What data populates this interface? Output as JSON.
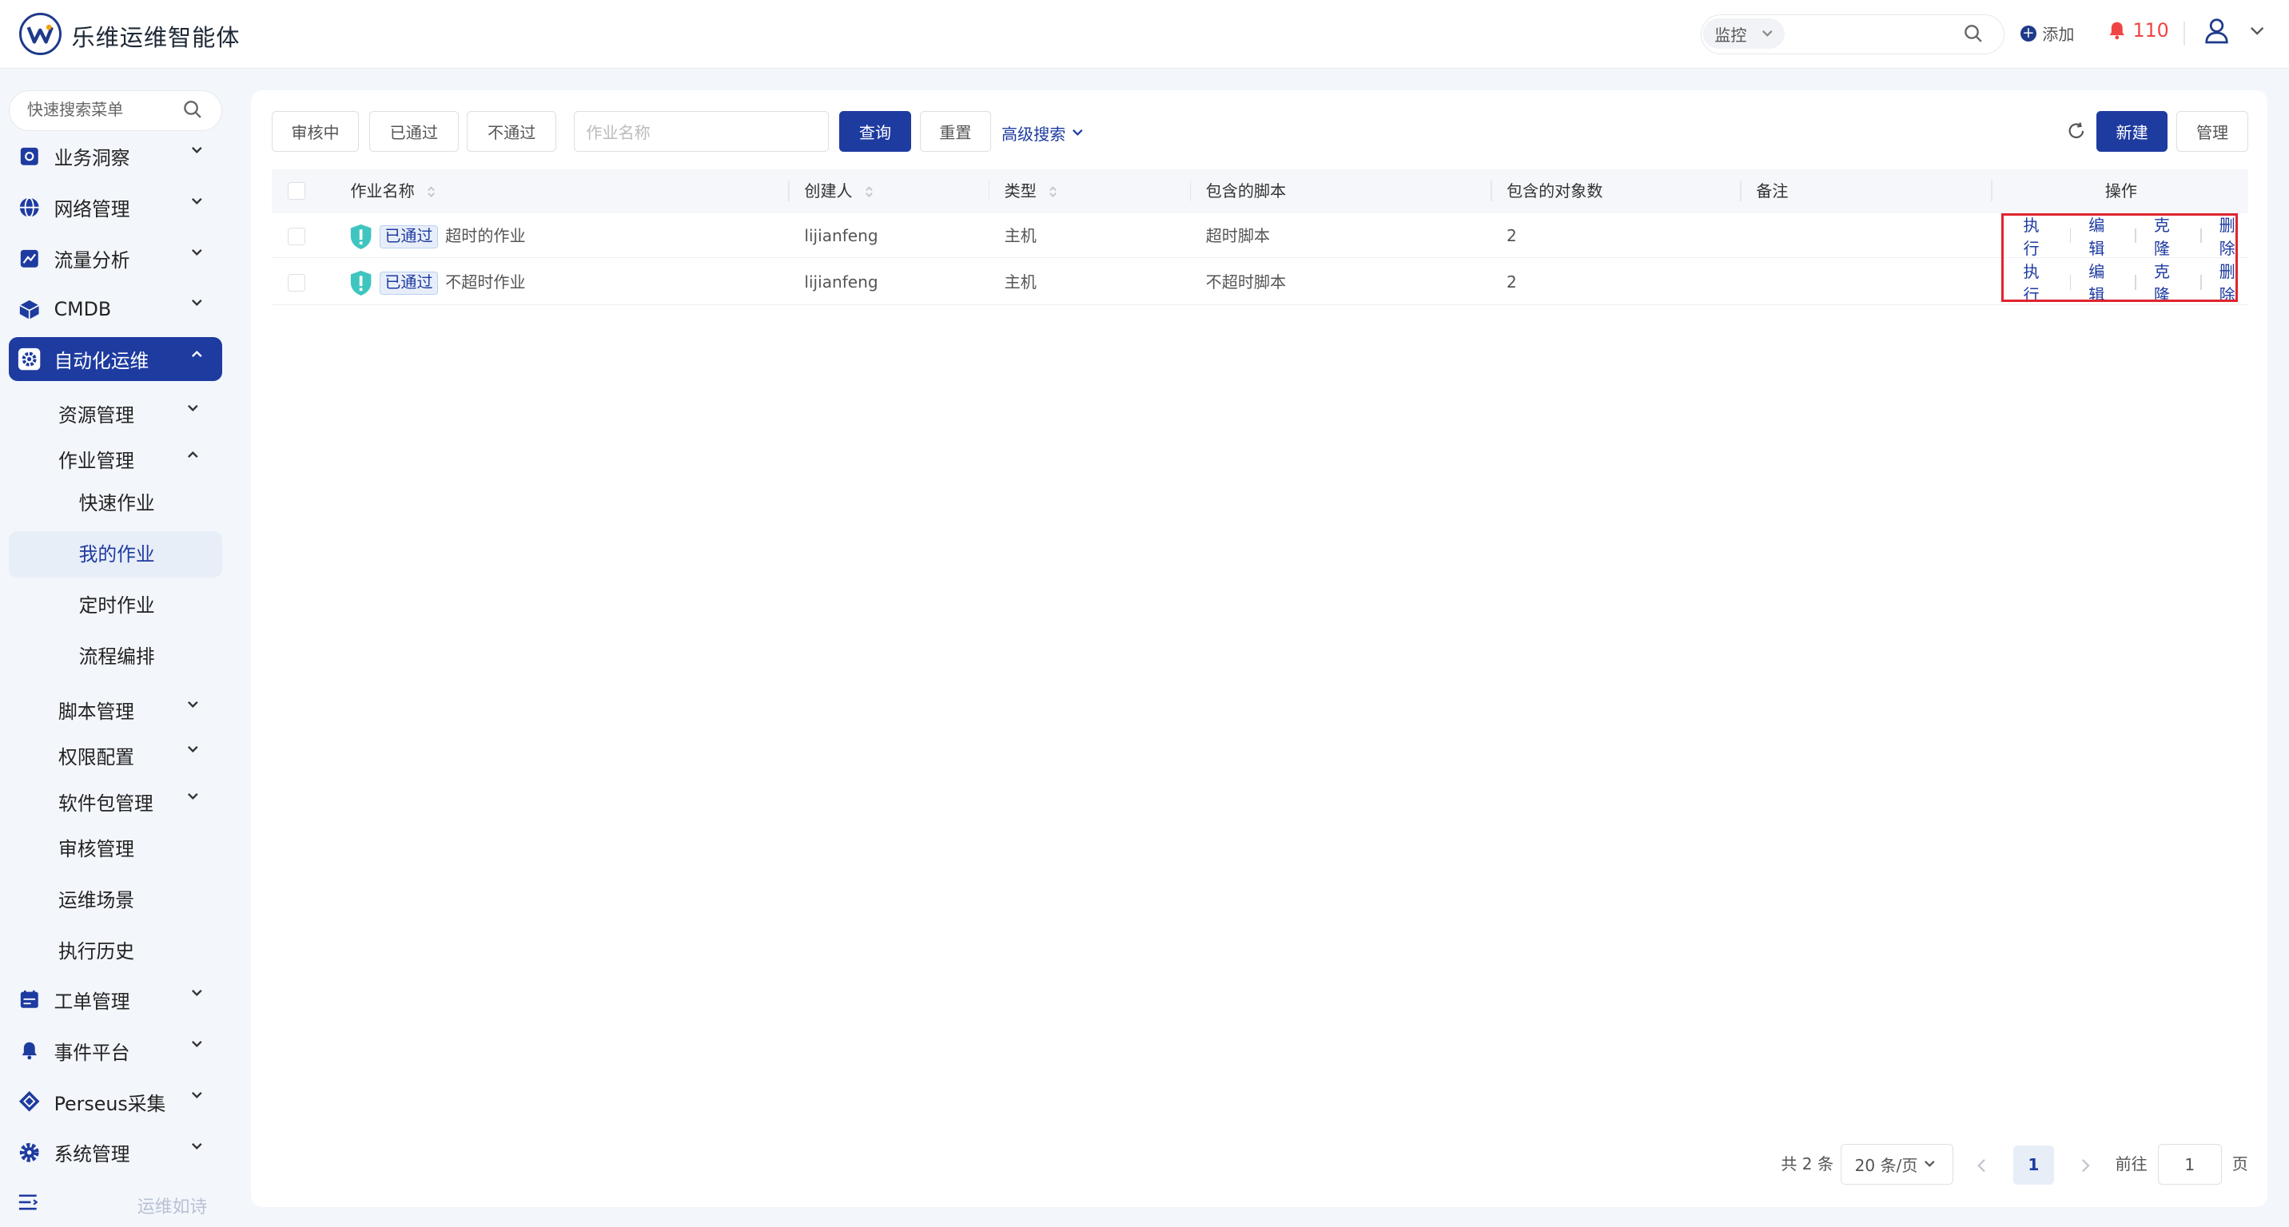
{
  "header": {
    "app_title": "乐维运维智能体",
    "search_scope": "监控",
    "add_label": "添加",
    "alert_count": "110"
  },
  "sidebar": {
    "search_placeholder": "快速搜索菜单",
    "items": [
      {
        "label": "业务洞察",
        "icon": "insight-icon"
      },
      {
        "label": "网络管理",
        "icon": "globe-icon"
      },
      {
        "label": "流量分析",
        "icon": "chart-icon"
      },
      {
        "label": "CMDB",
        "icon": "cube-icon"
      },
      {
        "label": "自动化运维",
        "icon": "gear-icon"
      },
      {
        "label": "工单管理",
        "icon": "calendar-icon"
      },
      {
        "label": "事件平台",
        "icon": "bell-icon"
      },
      {
        "label": "Perseus采集",
        "icon": "diamond-icon"
      },
      {
        "label": "系统管理",
        "icon": "settings-icon"
      }
    ],
    "sub_items": [
      "资源管理",
      "作业管理",
      "脚本管理",
      "权限配置",
      "软件包管理",
      "审核管理",
      "运维场景",
      "执行历史"
    ],
    "leaf_items": [
      "快速作业",
      "我的作业",
      "定时作业",
      "流程编排"
    ],
    "footer_text": "运维如诗"
  },
  "toolbar": {
    "filter_pending": "审核中",
    "filter_passed": "已通过",
    "filter_rejected": "不通过",
    "name_placeholder": "作业名称",
    "query": "查询",
    "reset": "重置",
    "advanced": "高级搜索",
    "new": "新建",
    "manage": "管理"
  },
  "table": {
    "columns": [
      "作业名称",
      "创建人",
      "类型",
      "包含的脚本",
      "包含的对象数",
      "备注",
      "操作"
    ],
    "rows": [
      {
        "status": "已通过",
        "name": "超时的作业",
        "creator": "lijianfeng",
        "type": "主机",
        "script": "超时脚本",
        "objects": "2",
        "note": ""
      },
      {
        "status": "已通过",
        "name": "不超时作业",
        "creator": "lijianfeng",
        "type": "主机",
        "script": "不超时脚本",
        "objects": "2",
        "note": ""
      }
    ],
    "actions": [
      "执行",
      "编辑",
      "克隆",
      "删除"
    ]
  },
  "pagination": {
    "total": "共 2 条",
    "page_size": "20 条/页",
    "current": "1",
    "goto_label": "前往",
    "goto_value": "1",
    "page_suffix": "页"
  },
  "colors": {
    "primary": "#1e3ba0",
    "highlight": "#e0242e",
    "alert": "#ef4444",
    "shield": "#3fc5c0"
  }
}
